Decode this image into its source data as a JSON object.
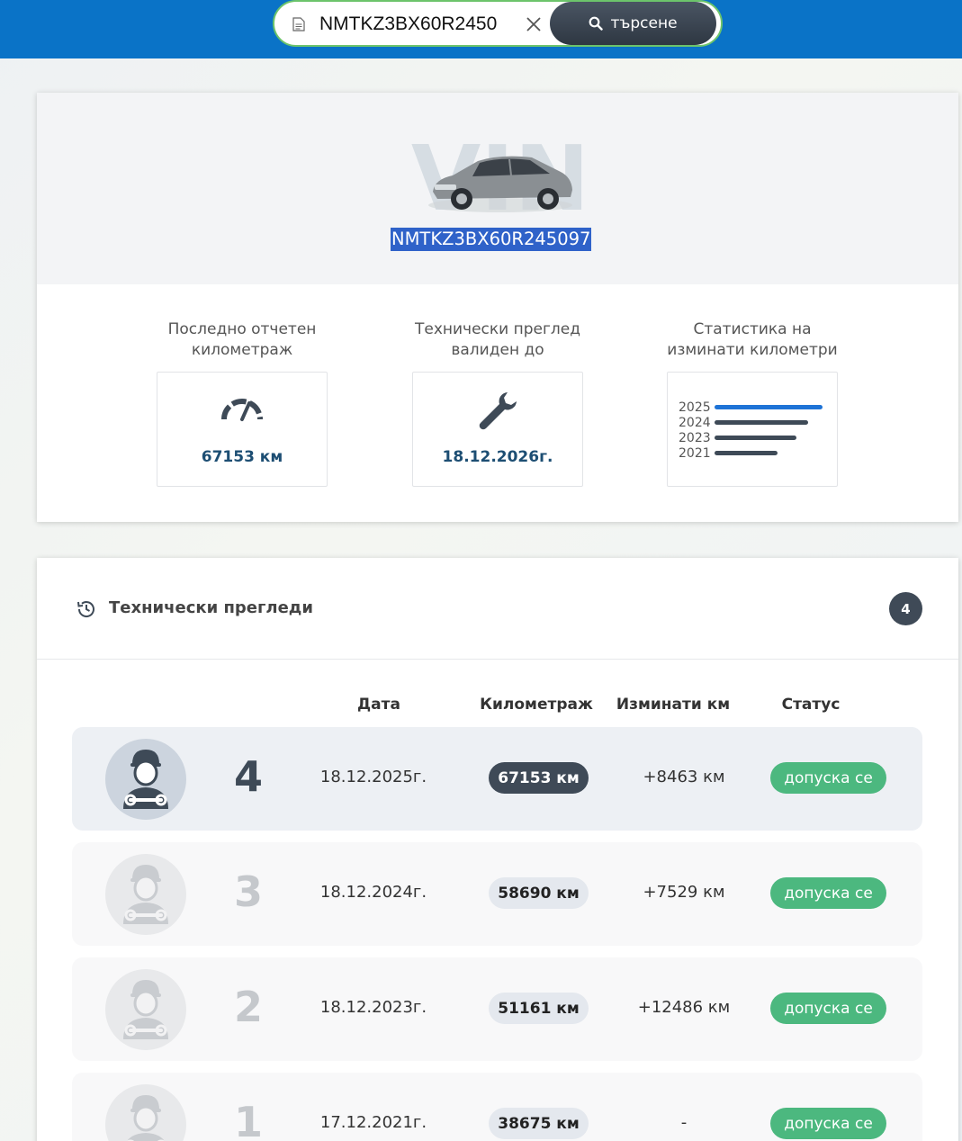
{
  "search": {
    "value": "NMTKZ3BX60R2450",
    "button_label": "търсене"
  },
  "vehicle": {
    "logo_text": "VIN",
    "vin": "NMTKZ3BX60R245097"
  },
  "stats": {
    "mileage": {
      "title_line1": "Последно отчетен",
      "title_line2": "километраж",
      "value": "67153 км"
    },
    "inspection": {
      "title_line1": "Технически преглед",
      "title_line2": "валиден до",
      "value": "18.12.2026г."
    },
    "statistics": {
      "title_line1": "Статистика на",
      "title_line2": "изминати километри",
      "years": [
        {
          "year": "2025",
          "fraction": 1.0,
          "highlight": true
        },
        {
          "year": "2024",
          "fraction": 0.87,
          "highlight": false
        },
        {
          "year": "2023",
          "fraction": 0.76,
          "highlight": false
        },
        {
          "year": "2021",
          "fraction": 0.58,
          "highlight": false
        }
      ]
    }
  },
  "inspections": {
    "title": "Технически прегледи",
    "count": "4",
    "columns": {
      "date": "Дата",
      "mileage": "Километраж",
      "diff": "Изминати км",
      "status": "Статус"
    },
    "rows": [
      {
        "num": "4",
        "date": "18.12.2025г.",
        "mileage": "67153 км",
        "diff": "+8463 км",
        "status": "допуска се"
      },
      {
        "num": "3",
        "date": "18.12.2024г.",
        "mileage": "58690 км",
        "diff": "+7529 км",
        "status": "допуска се"
      },
      {
        "num": "2",
        "date": "18.12.2023г.",
        "mileage": "51161 км",
        "diff": "+12486 км",
        "status": "допуска се"
      },
      {
        "num": "1",
        "date": "17.12.2021г.",
        "mileage": "38675 км",
        "diff": "-",
        "status": "допуска се"
      }
    ]
  },
  "colors": {
    "header": "#0a73c7",
    "accent_green": "#4cb87f",
    "dark": "#3f4a57",
    "highlight_bar": "#1e73d6"
  }
}
